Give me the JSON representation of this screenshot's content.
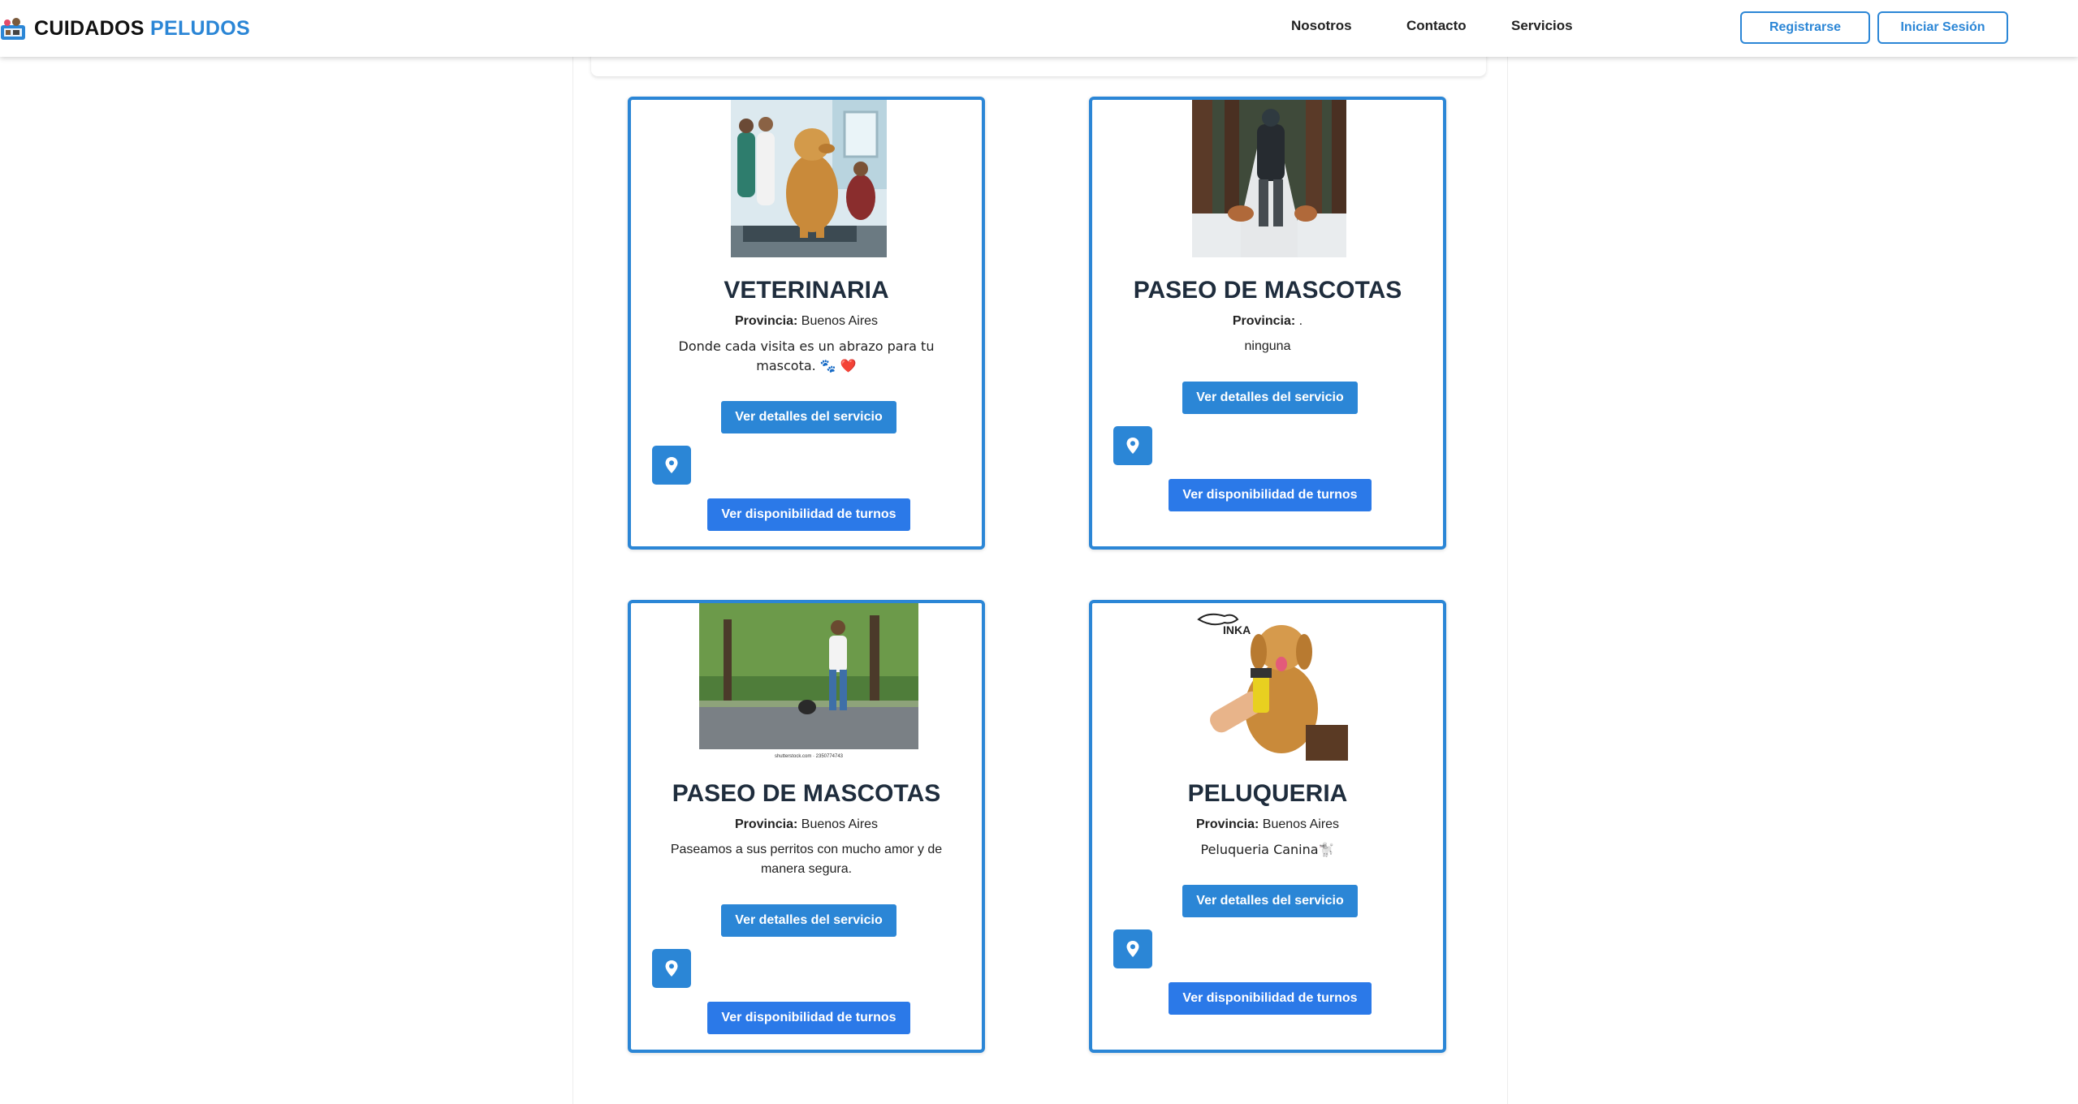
{
  "nav": {
    "brand_part1": "CUIDADOS",
    "brand_part2": "PELUDOS",
    "links": [
      "Nosotros",
      "Contacto",
      "Servicios"
    ],
    "register": "Registrarse",
    "login": "Iniciar Sesión"
  },
  "cards": [
    {
      "title": "VETERINARIA",
      "province_label": "Provincia:",
      "province": "Buenos Aires",
      "description": "Donde cada visita es un abrazo para tu mascota. 🐾 ❤️",
      "details_button": "Ver detalles del servicio",
      "location_icon": "map-pin-icon",
      "turnos_button": "Ver disponibilidad de turnos"
    },
    {
      "title": "PASEO DE MASCOTAS",
      "province_label": "Provincia:",
      "province": ".",
      "description": "ninguna",
      "details_button": "Ver detalles del servicio",
      "location_icon": "map-pin-icon",
      "turnos_button": "Ver disponibilidad de turnos"
    },
    {
      "title": "PASEO DE MASCOTAS",
      "province_label": "Provincia:",
      "province": "Buenos Aires",
      "description": "Paseamos a sus perritos con mucho amor y de manera segura.",
      "details_button": "Ver detalles del servicio",
      "location_icon": "map-pin-icon",
      "turnos_button": "Ver disponibilidad de turnos",
      "image_caption": "shutterstock.com · 2350774743"
    },
    {
      "title": "PELUQUERIA",
      "province_label": "Provincia:",
      "province": "Buenos Aires",
      "description": "Peluqueria Canina🐩",
      "details_button": "Ver detalles del servicio",
      "location_icon": "map-pin-icon",
      "turnos_button": "Ver disponibilidad de turnos",
      "image_logo": "INKA"
    }
  ],
  "colors": {
    "primary": "#2b86d6",
    "turnos": "#2b79e8",
    "title": "#1f2d3d"
  }
}
